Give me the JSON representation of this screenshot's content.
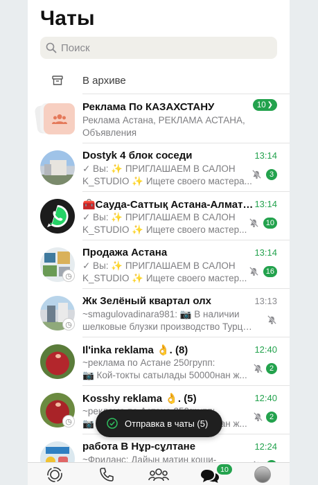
{
  "header": {
    "title": "Чаты"
  },
  "search": {
    "placeholder": "Поиск"
  },
  "archive": {
    "label": "В архиве"
  },
  "chats": [
    {
      "name": "Реклама По КАЗАХСТАНУ",
      "line1": "Реклама Астана, РЕКЛАМА АСТАНА,",
      "line2": "Объявления",
      "time": "",
      "badge": "10",
      "muted": false,
      "avatar": "community-icon"
    },
    {
      "name": "Dostyk 4 блок соседи",
      "line1": "✓ Вы: ✨ ПРИГЛАШАЕМ В САЛОН",
      "line2": "K_STUDIO ✨ Ищете своего мастера...",
      "time": "13:14",
      "badge": "3",
      "muted": true,
      "avatar": "building-photo"
    },
    {
      "name": "🧰Сауда-Саттық Астана-Алматы...",
      "line1": "✓ Вы: ✨ ПРИГЛАШАЕМ В САЛОН",
      "line2": "K_STUDIO ✨ Ищете своего мастер...",
      "time": "13:14",
      "badge": "10",
      "muted": true,
      "avatar": "whatsapp-logo"
    },
    {
      "name": "Продажа Астана",
      "line1": "✓ Вы: ✨ ПРИГЛАШАЕМ В САЛОН",
      "line2": "K_STUDIO ✨ Ищете своего мастер...",
      "time": "13:14",
      "badge": "16",
      "muted": true,
      "avatar": "collage-photo"
    },
    {
      "name": "Жк Зелёный квартал олх",
      "line1": "~smagulovadinara981: 📷 В наличии",
      "line2": "шелковые блузки производство Турци...",
      "time": "13:13",
      "badge": "",
      "muted": true,
      "avatar": "city-photo"
    },
    {
      "name": "Il'inka reklama 👌. (8)",
      "line1": "~реклама по Астане 250групп:",
      "line2": "📷 Кой-токты сатылады 50000нан ж...",
      "time": "12:40",
      "badge": "2",
      "muted": true,
      "avatar": "apple-photo"
    },
    {
      "name": "Kosshy  reklama 👌.  (5)",
      "line1": "~реклама по Астане 250групп:",
      "line2": "📷 Кой-токты сатылады 50000нан ж...",
      "time": "12:40",
      "badge": "2",
      "muted": true,
      "avatar": "apple-photo-2"
    },
    {
      "name": "работа В Нұр-сұлтане",
      "line1": "~Фриланс: Дайын матин коши-",
      "line2": "",
      "time": "12:24",
      "badge": "1",
      "muted": true,
      "avatar": "ad-photo"
    }
  ],
  "toast": {
    "text": "Отправка в чаты (5)"
  },
  "tabbar": {
    "chats_badge": "10"
  },
  "colors": {
    "accent": "#23a24d"
  }
}
